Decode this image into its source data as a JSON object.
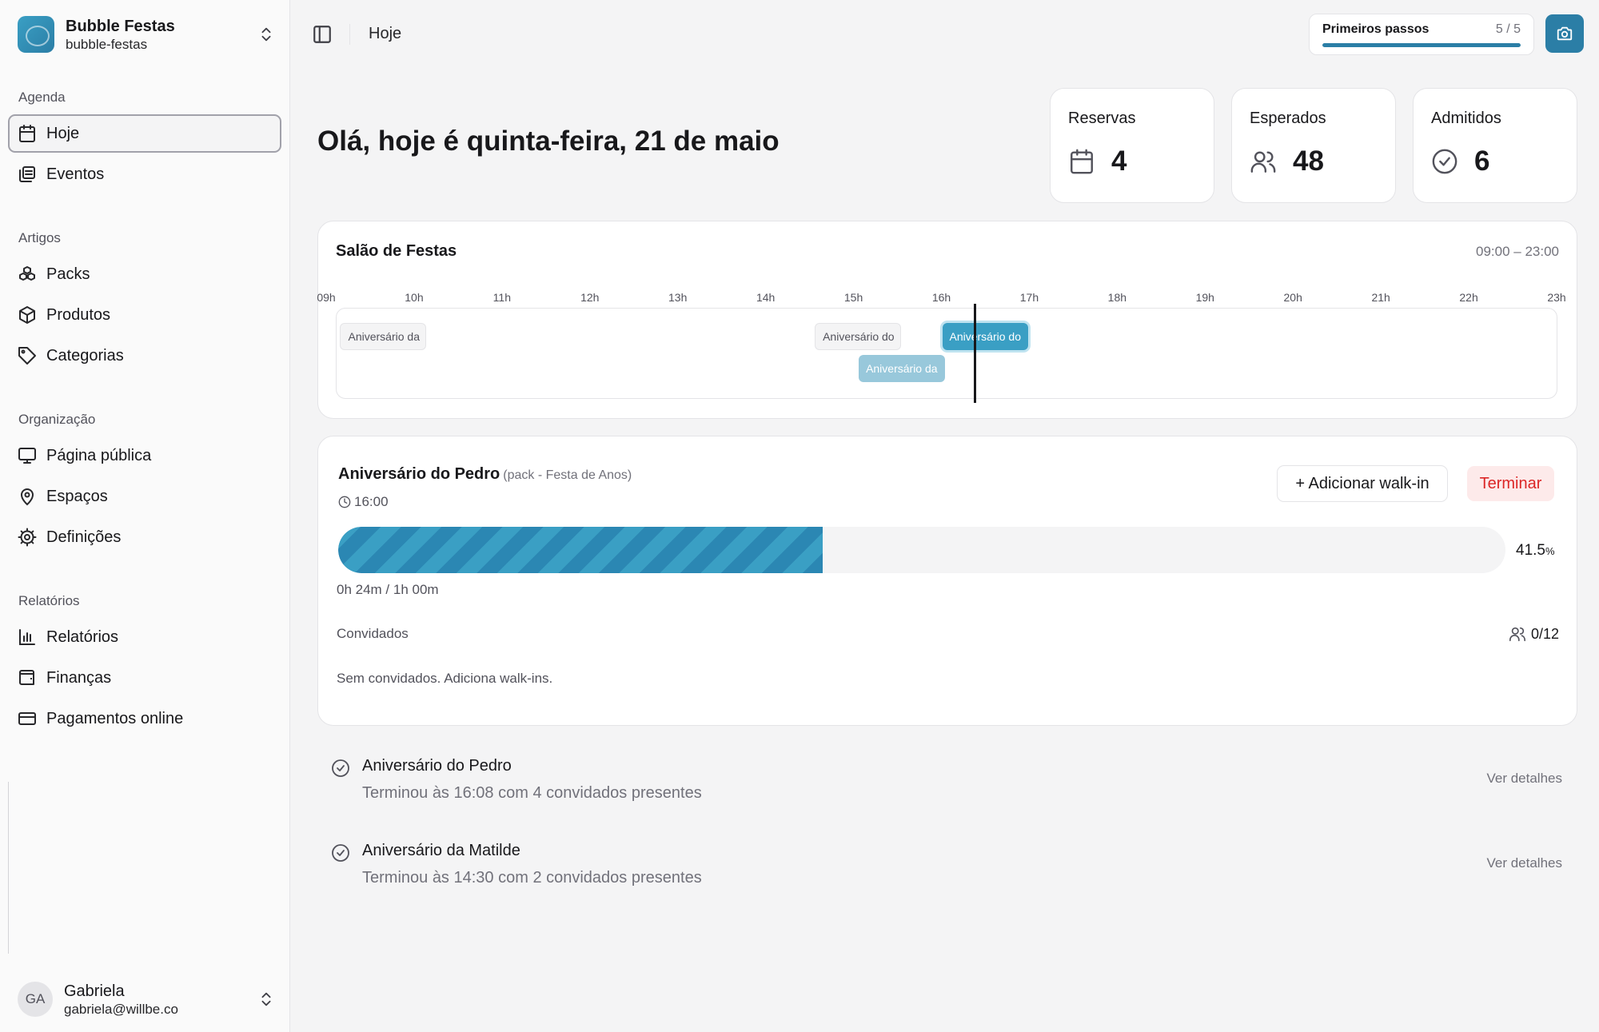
{
  "org": {
    "name": "Bubble Festas",
    "slug": "bubble-festas"
  },
  "sidebar": {
    "groups": [
      {
        "label": "Agenda",
        "items": [
          {
            "label": "Hoje",
            "icon": "calendar-icon",
            "active": true
          },
          {
            "label": "Eventos",
            "icon": "calendar-stack-icon"
          }
        ]
      },
      {
        "label": "Artigos",
        "items": [
          {
            "label": "Packs",
            "icon": "boxes-icon"
          },
          {
            "label": "Produtos",
            "icon": "package-icon"
          },
          {
            "label": "Categorias",
            "icon": "tag-icon"
          }
        ]
      },
      {
        "label": "Organização",
        "items": [
          {
            "label": "Página pública",
            "icon": "monitor-icon"
          },
          {
            "label": "Espaços",
            "icon": "map-pin-icon"
          },
          {
            "label": "Definições",
            "icon": "gear-icon"
          }
        ]
      },
      {
        "label": "Relatórios",
        "items": [
          {
            "label": "Relatórios",
            "icon": "bar-chart-icon"
          },
          {
            "label": "Finanças",
            "icon": "wallet-icon"
          },
          {
            "label": "Pagamentos online",
            "icon": "credit-card-icon"
          }
        ]
      }
    ]
  },
  "user": {
    "initials": "GA",
    "name": "Gabriela",
    "email": "gabriela@willbe.co"
  },
  "header": {
    "breadcrumb": "Hoje",
    "steps": {
      "title": "Primeiros passos",
      "count": "5 / 5",
      "progress": 1.0
    }
  },
  "greeting": "Olá, hoje é quinta-feira, 21 de maio",
  "stats": [
    {
      "label": "Reservas",
      "value": "4",
      "icon": "calendar-icon"
    },
    {
      "label": "Esperados",
      "value": "48",
      "icon": "users-icon"
    },
    {
      "label": "Admitidos",
      "value": "6",
      "icon": "check-circle-icon"
    }
  ],
  "timeline": {
    "title": "Salão de Festas",
    "range": "09:00 – 23:00",
    "hours": [
      "09h",
      "10h",
      "11h",
      "12h",
      "13h",
      "14h",
      "15h",
      "16h",
      "17h",
      "18h",
      "19h",
      "20h",
      "21h",
      "22h",
      "23h"
    ],
    "events": [
      {
        "label": "Aniversário da",
        "start": 9.15,
        "end": 10.15,
        "row": 0,
        "style": "gray"
      },
      {
        "label": "Aniversário do",
        "start": 14.55,
        "end": 15.55,
        "row": 0,
        "style": "gray"
      },
      {
        "label": "Aniversário do",
        "start": 16.0,
        "end": 17.0,
        "row": 0,
        "style": "blue"
      },
      {
        "label": "Aniversário da",
        "start": 15.05,
        "end": 16.05,
        "row": 1,
        "style": "light"
      }
    ],
    "now": 16.4
  },
  "current": {
    "title": "Aniversário do Pedro",
    "subtitle": "(pack - Festa de Anos)",
    "time": "16:00",
    "walkin_label": "+ Adicionar walk-in",
    "finish_label": "Terminar",
    "progress": 0.415,
    "percent": "41.5",
    "percent_unit": "%",
    "duration": "0h 24m / 1h 00m",
    "guests_label": "Convidados",
    "guests_count": "0/12",
    "empty": "Sem convidados. Adiciona walk-ins."
  },
  "past": [
    {
      "title": "Aniversário do Pedro",
      "desc": "Terminou às 16:08 com 4 convidados presentes",
      "link": "Ver detalhes"
    },
    {
      "title": "Aniversário da Matilde",
      "desc": "Terminou às 14:30 com 2 convidados presentes",
      "link": "Ver detalhes"
    }
  ],
  "colors": {
    "accent": "#2b7ea6",
    "danger": "#dc2626"
  }
}
